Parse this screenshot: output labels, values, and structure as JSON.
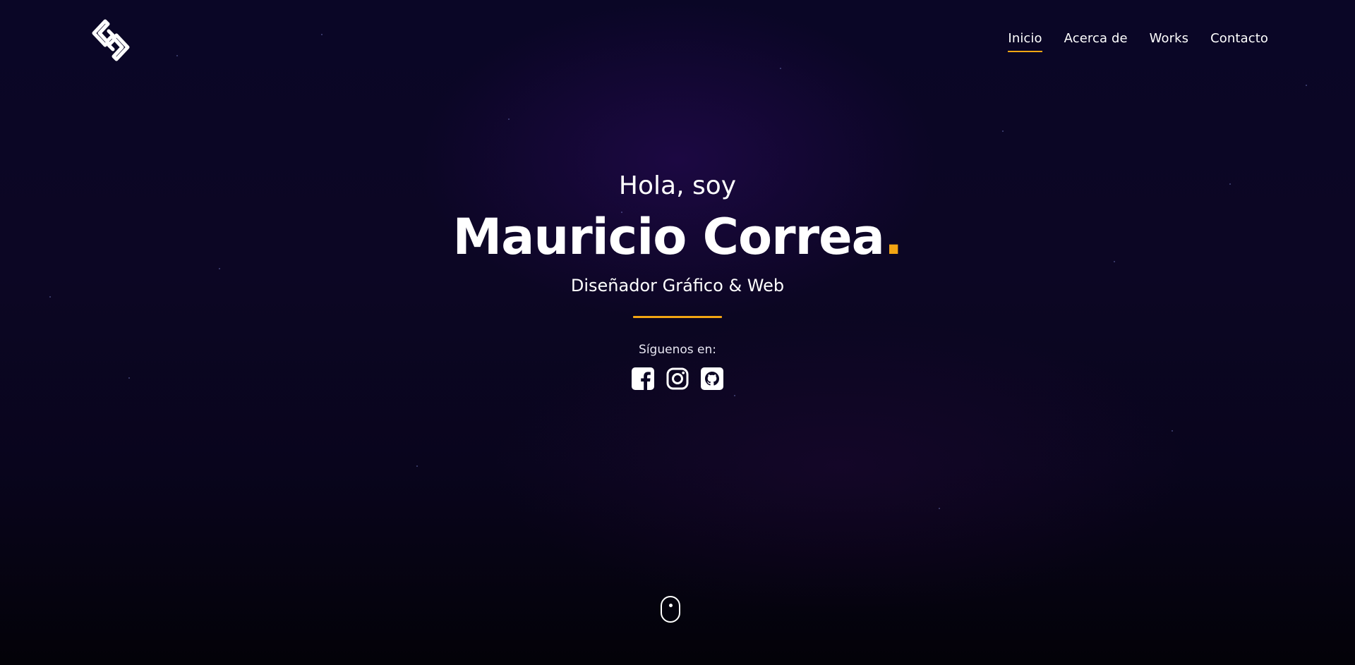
{
  "header": {
    "logo_icon": "code-arrows-logo-icon",
    "nav": [
      {
        "label": "Inicio",
        "active": true
      },
      {
        "label": "Acerca de",
        "active": false
      },
      {
        "label": "Works",
        "active": false
      },
      {
        "label": "Contacto",
        "active": false
      }
    ]
  },
  "hero": {
    "greeting": "Hola, soy",
    "name": "Mauricio Correa",
    "name_dot": ".",
    "role": "Diseñador Gráfico & Web",
    "follow_label": "Síguenos en:",
    "socials": [
      {
        "icon": "facebook-icon"
      },
      {
        "icon": "instagram-icon"
      },
      {
        "icon": "github-icon"
      }
    ]
  },
  "scroll_indicator_icon": "mouse-scroll-icon",
  "colors": {
    "accent": "#f3a513",
    "background": "#0a0626",
    "text": "#ffffff"
  }
}
